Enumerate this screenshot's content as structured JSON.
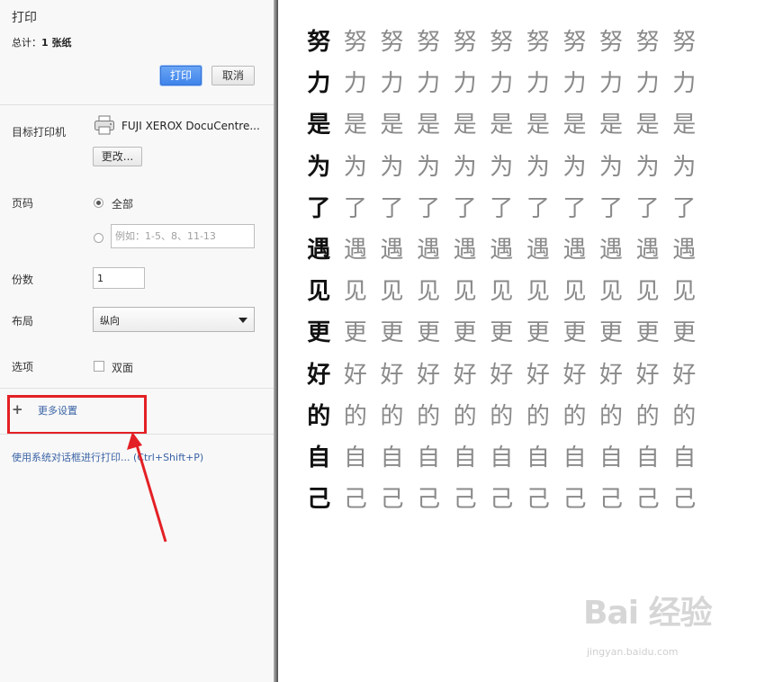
{
  "panel": {
    "title": "打印",
    "summary_prefix": "总计：",
    "summary_count": "1 张纸",
    "print_button": "打印",
    "cancel_button": "取消",
    "destination": {
      "label": "目标打印机",
      "printer_name": "FUJI XEROX DocuCentre...",
      "change_button": "更改..."
    },
    "pages": {
      "label": "页码",
      "all_label": "全部",
      "all_selected": true,
      "range_placeholder": "例如：1-5、8、11-13"
    },
    "copies": {
      "label": "份数",
      "value": "1"
    },
    "layout": {
      "label": "布局",
      "value": "纵向"
    },
    "options": {
      "label": "选项",
      "duplex_label": "双面",
      "duplex_checked": false
    },
    "more_settings": "更多设置",
    "system_dialog_link": "使用系统对话框进行打印... (Ctrl+Shift+P)"
  },
  "annotation": {
    "color": "#e32025"
  },
  "preview": {
    "rows": [
      "努",
      "力",
      "是",
      "为",
      "了",
      "遇",
      "见",
      "更",
      "好",
      "的",
      "自",
      "己"
    ],
    "repeat": 11
  },
  "watermark": {
    "logo": "Bai 经验",
    "url": "jingyan.baidu.com"
  },
  "colors": {
    "accent": "#3f84ea",
    "link": "#3a63a5"
  }
}
